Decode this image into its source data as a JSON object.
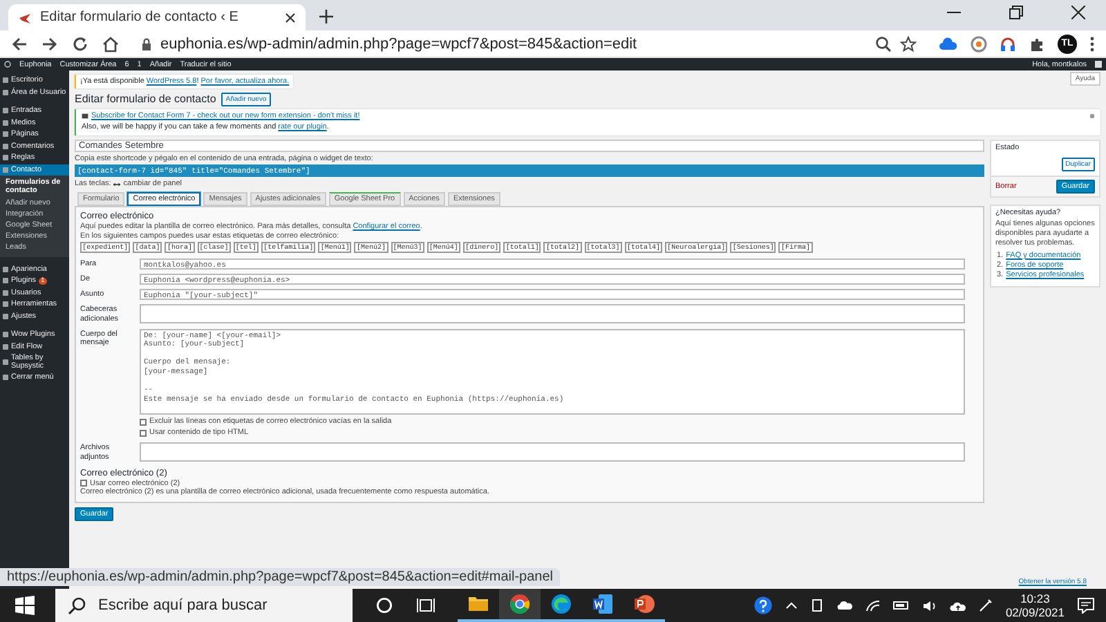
{
  "browser": {
    "tab_title": "Editar formulario de contacto ‹ E",
    "url": "euphonia.es/wp-admin/admin.php?page=wpcf7&post=845&action=edit",
    "profile_initials": "TL",
    "status_url": "https://euphonia.es/wp-admin/admin.php?page=wpcf7&post=845&action=edit#mail-panel"
  },
  "admin_bar": {
    "items": [
      "Euphonia",
      "Customizar Área",
      "6",
      "1",
      "Añadir",
      "Traducir el sitio"
    ],
    "greeting": "Hola, montkalos"
  },
  "sidebar": {
    "groups": [
      {
        "items": [
          {
            "label": "Escritorio",
            "selected": false
          },
          {
            "label": "Área de Usuario",
            "selected": false
          }
        ]
      },
      {
        "items": [
          {
            "label": "Entradas",
            "selected": false
          },
          {
            "label": "Medios",
            "selected": false
          },
          {
            "label": "Páginas",
            "selected": false
          },
          {
            "label": "Comentarios",
            "selected": false
          },
          {
            "label": "Reglas",
            "selected": false
          },
          {
            "label": "Contacto",
            "selected": true,
            "children": [
              {
                "label": "Formularios de contacto",
                "selected": true
              },
              {
                "label": "Añadir nuevo",
                "selected": false
              },
              {
                "label": "Integración",
                "selected": false
              },
              {
                "label": "Google Sheet",
                "selected": false
              },
              {
                "label": "Extensiones",
                "selected": false
              },
              {
                "label": "Leads",
                "selected": false
              }
            ]
          }
        ]
      },
      {
        "items": [
          {
            "label": "Apariencia",
            "selected": false
          },
          {
            "label": "Plugins",
            "selected": false,
            "badge": "1"
          },
          {
            "label": "Usuarios",
            "selected": false
          },
          {
            "label": "Herramientas",
            "selected": false
          },
          {
            "label": "Ajustes",
            "selected": false
          }
        ]
      },
      {
        "items": [
          {
            "label": "Wow Plugins",
            "selected": false
          },
          {
            "label": "Edit Flow",
            "selected": false
          },
          {
            "label": "Tables by Supsystic",
            "selected": false
          },
          {
            "label": "Cerrar menú",
            "selected": false
          }
        ]
      }
    ]
  },
  "help_tab": "Ayuda",
  "update_notice": {
    "parts": [
      {
        "text": "¡Ya está disponible ",
        "link": false
      },
      {
        "text": "WordPress 5.8",
        "link": true
      },
      {
        "text": "! ",
        "link": false
      },
      {
        "text": "Por favor, actualiza ahora.",
        "link": true
      }
    ]
  },
  "page_title": "Editar formulario de contacto",
  "add_new_button": "Añadir nuevo",
  "promo_notice": {
    "lines": [
      {
        "parts": [
          {
            "text": "Subscribe for Contact Form 7 - check out our new form extension - don't miss it!",
            "link": true
          }
        ]
      },
      {
        "parts": [
          {
            "text": "Also, we will be happy if you can take a few moments and ",
            "link": false
          },
          {
            "text": "rate our plugin",
            "link": true
          },
          {
            "text": ".",
            "link": false
          }
        ]
      }
    ]
  },
  "form_title": "Comandes Setembre",
  "shortcode_hint": "Copia este shortcode y pégalo en el contenido de una entrada, página o widget de texto:",
  "shortcode": "[contact-form-7 id=\"845\" title=\"Comandes Setembre\"]",
  "keys_label": "Las teclas:",
  "keys_hint": "cambiar de panel",
  "tabs": [
    {
      "label": "Formulario",
      "selected": false,
      "accent": false
    },
    {
      "label": "Correo electrónico",
      "selected": true,
      "accent": false
    },
    {
      "label": "Mensajes",
      "selected": false,
      "accent": false
    },
    {
      "label": "Ajustes adicionales",
      "selected": false,
      "accent": false
    },
    {
      "label": "Google Sheet Pro",
      "selected": false,
      "accent": true
    },
    {
      "label": "Acciones",
      "selected": false,
      "accent": false
    },
    {
      "label": "Extensiones",
      "selected": false,
      "accent": false
    }
  ],
  "mail": {
    "heading": "Correo electrónico",
    "intro": {
      "parts": [
        {
          "text": "Aquí puedes editar la plantilla de correo electrónico. Para más detalles, consulta ",
          "link": false
        },
        {
          "text": "Configurar el correo",
          "link": true
        },
        {
          "text": ".",
          "link": false
        }
      ]
    },
    "tags_hint": "En los siguientes campos puedes usar estas etiquetas de correo electrónico:",
    "tags": [
      "[expedient]",
      "[data]",
      "[hora]",
      "[clase]",
      "[tel]",
      "[telfamilia]",
      "[Menú1]",
      "[Menú2]",
      "[Menú3]",
      "[Menú4]",
      "[dinero]",
      "[total1]",
      "[total2]",
      "[total3]",
      "[total4]",
      "[Neuroalergia]",
      "[Sesiones]",
      "[Firma]"
    ],
    "fields": [
      {
        "kind": "input",
        "label": "Para",
        "value": "montkalos@yahoo.es"
      },
      {
        "kind": "input",
        "label": "De",
        "value": "Euphonia <wordpress@euphonia.es>"
      },
      {
        "kind": "input",
        "label": "Asunto",
        "value": "Euphonia \"[your-subject]\""
      },
      {
        "kind": "textarea",
        "label": "Cabeceras adicionales"
      },
      {
        "kind": "body",
        "label": "Cuerpo del mensaje",
        "value": "De: [your-name] <[your-email]>\nAsunto: [your-subject]\n\nCuerpo del mensaje:\n[your-message]\n\n-- \nEste mensaje se ha enviado desde un formulario de contacto en Euphonia (https://euphonia.es)"
      },
      {
        "kind": "checkbox",
        "label": "Excluir las líneas con etiquetas de correo electrónico vacías en la salida",
        "checked": false
      },
      {
        "kind": "checkbox",
        "label": "Usar contenido de tipo HTML",
        "checked": false
      },
      {
        "kind": "textarea",
        "label": "Archivos adjuntos"
      }
    ],
    "mail2_heading": "Correo electrónico (2)",
    "mail2_checkbox": {
      "label": "Usar correo electrónico (2)",
      "checked": false
    },
    "mail2_note": "Correo electrónico (2) es una plantilla de correo electrónico adicional, usada frecuentemente como respuesta automática."
  },
  "save_button": "Guardar",
  "status_box": {
    "title": "Estado",
    "duplicate": "Duplicar",
    "delete": "Borrar",
    "save": "Guardar"
  },
  "help_box": {
    "title": "¿Necesitas ayuda?",
    "text": "Aquí tienes algunas opciones disponibles para ayudarte a resolver tus problemas.",
    "links": [
      {
        "marker": "1.",
        "text": "FAQ y documentación"
      },
      {
        "marker": "2.",
        "text": "Foros de soporte"
      },
      {
        "marker": "3.",
        "text": "Servicios profesionales"
      }
    ]
  },
  "footer_link": "Obtener la versión 5.8",
  "taskbar": {
    "search_placeholder": "Escribe aquí para buscar",
    "apps": [
      {
        "kind": "explorer",
        "active": false
      },
      {
        "kind": "chrome",
        "active": true
      },
      {
        "kind": "edge",
        "active": false
      },
      {
        "kind": "word",
        "active": false
      },
      {
        "kind": "powerpoint",
        "active": false
      }
    ],
    "time": "10:23",
    "date": "02/09/2021"
  }
}
